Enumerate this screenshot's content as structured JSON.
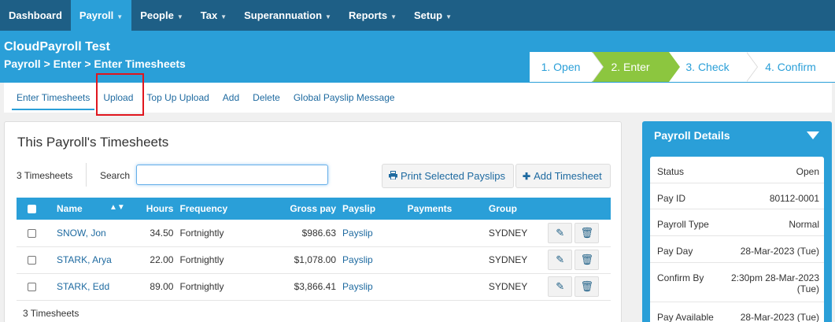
{
  "topnav": [
    {
      "label": "Dashboard",
      "caret": false,
      "active": false
    },
    {
      "label": "Payroll",
      "caret": true,
      "active": true
    },
    {
      "label": "People",
      "caret": true,
      "active": false
    },
    {
      "label": "Tax",
      "caret": true,
      "active": false
    },
    {
      "label": "Superannuation",
      "caret": true,
      "active": false
    },
    {
      "label": "Reports",
      "caret": true,
      "active": false
    },
    {
      "label": "Setup",
      "caret": true,
      "active": false
    }
  ],
  "header": {
    "org": "CloudPayroll Test",
    "breadcrumb": "Payroll > Enter > Enter Timesheets"
  },
  "steps": [
    "1. Open",
    "2. Enter",
    "3. Check",
    "4. Confirm"
  ],
  "subnav": [
    "Enter Timesheets",
    "Upload",
    "Top Up Upload",
    "Add",
    "Delete",
    "Global Payslip Message"
  ],
  "panel": {
    "title": "This Payroll's Timesheets",
    "count_label": "3 Timesheets",
    "search_label": "Search",
    "search_value": "",
    "print_label": "Print Selected Payslips",
    "add_label": "Add Timesheet",
    "footer_count": "3 Timesheets"
  },
  "table": {
    "columns": [
      "Name",
      "Hours",
      "Frequency",
      "Gross pay",
      "Payslip",
      "Payments",
      "Group"
    ],
    "rows": [
      {
        "name": "SNOW, Jon",
        "hours": "34.50",
        "frequency": "Fortnightly",
        "gross": "$986.63",
        "payslip": "Payslip",
        "payments": "",
        "group": "SYDNEY"
      },
      {
        "name": "STARK, Arya",
        "hours": "22.00",
        "frequency": "Fortnightly",
        "gross": "$1,078.00",
        "payslip": "Payslip",
        "payments": "",
        "group": "SYDNEY"
      },
      {
        "name": "STARK, Edd",
        "hours": "89.00",
        "frequency": "Fortnightly",
        "gross": "$3,866.41",
        "payslip": "Payslip",
        "payments": "",
        "group": "SYDNEY"
      }
    ]
  },
  "details": {
    "title": "Payroll Details",
    "rows": [
      {
        "key": "Status",
        "value": "Open"
      },
      {
        "key": "Pay ID",
        "value": "80112-0001"
      },
      {
        "key": "Payroll Type",
        "value": "Normal"
      },
      {
        "key": "Pay Day",
        "value": "28-Mar-2023 (Tue)"
      },
      {
        "key": "Confirm By",
        "value": "2:30pm 28-Mar-2023",
        "value2": "(Tue)"
      },
      {
        "key": "Pay Available",
        "value": "28-Mar-2023 (Tue)"
      }
    ]
  },
  "colors": {
    "nav": "#1e5f86",
    "accent": "#2a9fd8",
    "step_active": "#8cc63f",
    "highlight": "#e0161e"
  },
  "icons": {
    "print": "print-icon",
    "add": "plus-icon",
    "edit": "pencil-icon",
    "delete": "trash-icon",
    "sort": "sort-icon",
    "collapse": "triangle-down-icon"
  }
}
